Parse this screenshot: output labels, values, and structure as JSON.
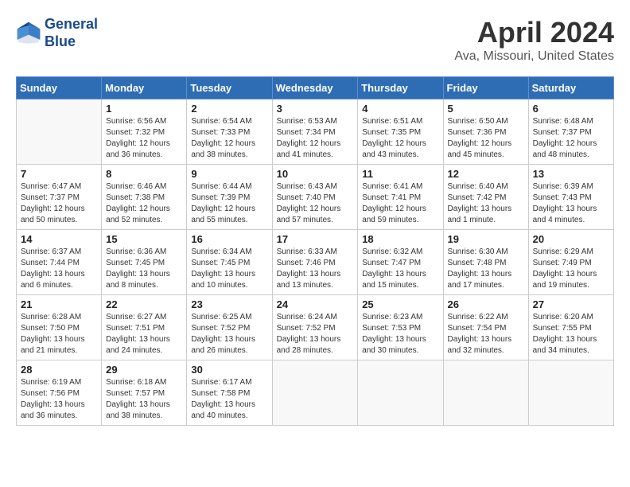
{
  "header": {
    "logo_line1": "General",
    "logo_line2": "Blue",
    "title": "April 2024",
    "subtitle": "Ava, Missouri, United States"
  },
  "days_of_week": [
    "Sunday",
    "Monday",
    "Tuesday",
    "Wednesday",
    "Thursday",
    "Friday",
    "Saturday"
  ],
  "weeks": [
    [
      {
        "day": "",
        "sunrise": "",
        "sunset": "",
        "daylight": "",
        "empty": true
      },
      {
        "day": "1",
        "sunrise": "Sunrise: 6:56 AM",
        "sunset": "Sunset: 7:32 PM",
        "daylight": "Daylight: 12 hours and 36 minutes."
      },
      {
        "day": "2",
        "sunrise": "Sunrise: 6:54 AM",
        "sunset": "Sunset: 7:33 PM",
        "daylight": "Daylight: 12 hours and 38 minutes."
      },
      {
        "day": "3",
        "sunrise": "Sunrise: 6:53 AM",
        "sunset": "Sunset: 7:34 PM",
        "daylight": "Daylight: 12 hours and 41 minutes."
      },
      {
        "day": "4",
        "sunrise": "Sunrise: 6:51 AM",
        "sunset": "Sunset: 7:35 PM",
        "daylight": "Daylight: 12 hours and 43 minutes."
      },
      {
        "day": "5",
        "sunrise": "Sunrise: 6:50 AM",
        "sunset": "Sunset: 7:36 PM",
        "daylight": "Daylight: 12 hours and 45 minutes."
      },
      {
        "day": "6",
        "sunrise": "Sunrise: 6:48 AM",
        "sunset": "Sunset: 7:37 PM",
        "daylight": "Daylight: 12 hours and 48 minutes."
      }
    ],
    [
      {
        "day": "7",
        "sunrise": "Sunrise: 6:47 AM",
        "sunset": "Sunset: 7:37 PM",
        "daylight": "Daylight: 12 hours and 50 minutes."
      },
      {
        "day": "8",
        "sunrise": "Sunrise: 6:46 AM",
        "sunset": "Sunset: 7:38 PM",
        "daylight": "Daylight: 12 hours and 52 minutes."
      },
      {
        "day": "9",
        "sunrise": "Sunrise: 6:44 AM",
        "sunset": "Sunset: 7:39 PM",
        "daylight": "Daylight: 12 hours and 55 minutes."
      },
      {
        "day": "10",
        "sunrise": "Sunrise: 6:43 AM",
        "sunset": "Sunset: 7:40 PM",
        "daylight": "Daylight: 12 hours and 57 minutes."
      },
      {
        "day": "11",
        "sunrise": "Sunrise: 6:41 AM",
        "sunset": "Sunset: 7:41 PM",
        "daylight": "Daylight: 12 hours and 59 minutes."
      },
      {
        "day": "12",
        "sunrise": "Sunrise: 6:40 AM",
        "sunset": "Sunset: 7:42 PM",
        "daylight": "Daylight: 13 hours and 1 minute."
      },
      {
        "day": "13",
        "sunrise": "Sunrise: 6:39 AM",
        "sunset": "Sunset: 7:43 PM",
        "daylight": "Daylight: 13 hours and 4 minutes."
      }
    ],
    [
      {
        "day": "14",
        "sunrise": "Sunrise: 6:37 AM",
        "sunset": "Sunset: 7:44 PM",
        "daylight": "Daylight: 13 hours and 6 minutes."
      },
      {
        "day": "15",
        "sunrise": "Sunrise: 6:36 AM",
        "sunset": "Sunset: 7:45 PM",
        "daylight": "Daylight: 13 hours and 8 minutes."
      },
      {
        "day": "16",
        "sunrise": "Sunrise: 6:34 AM",
        "sunset": "Sunset: 7:45 PM",
        "daylight": "Daylight: 13 hours and 10 minutes."
      },
      {
        "day": "17",
        "sunrise": "Sunrise: 6:33 AM",
        "sunset": "Sunset: 7:46 PM",
        "daylight": "Daylight: 13 hours and 13 minutes."
      },
      {
        "day": "18",
        "sunrise": "Sunrise: 6:32 AM",
        "sunset": "Sunset: 7:47 PM",
        "daylight": "Daylight: 13 hours and 15 minutes."
      },
      {
        "day": "19",
        "sunrise": "Sunrise: 6:30 AM",
        "sunset": "Sunset: 7:48 PM",
        "daylight": "Daylight: 13 hours and 17 minutes."
      },
      {
        "day": "20",
        "sunrise": "Sunrise: 6:29 AM",
        "sunset": "Sunset: 7:49 PM",
        "daylight": "Daylight: 13 hours and 19 minutes."
      }
    ],
    [
      {
        "day": "21",
        "sunrise": "Sunrise: 6:28 AM",
        "sunset": "Sunset: 7:50 PM",
        "daylight": "Daylight: 13 hours and 21 minutes."
      },
      {
        "day": "22",
        "sunrise": "Sunrise: 6:27 AM",
        "sunset": "Sunset: 7:51 PM",
        "daylight": "Daylight: 13 hours and 24 minutes."
      },
      {
        "day": "23",
        "sunrise": "Sunrise: 6:25 AM",
        "sunset": "Sunset: 7:52 PM",
        "daylight": "Daylight: 13 hours and 26 minutes."
      },
      {
        "day": "24",
        "sunrise": "Sunrise: 6:24 AM",
        "sunset": "Sunset: 7:52 PM",
        "daylight": "Daylight: 13 hours and 28 minutes."
      },
      {
        "day": "25",
        "sunrise": "Sunrise: 6:23 AM",
        "sunset": "Sunset: 7:53 PM",
        "daylight": "Daylight: 13 hours and 30 minutes."
      },
      {
        "day": "26",
        "sunrise": "Sunrise: 6:22 AM",
        "sunset": "Sunset: 7:54 PM",
        "daylight": "Daylight: 13 hours and 32 minutes."
      },
      {
        "day": "27",
        "sunrise": "Sunrise: 6:20 AM",
        "sunset": "Sunset: 7:55 PM",
        "daylight": "Daylight: 13 hours and 34 minutes."
      }
    ],
    [
      {
        "day": "28",
        "sunrise": "Sunrise: 6:19 AM",
        "sunset": "Sunset: 7:56 PM",
        "daylight": "Daylight: 13 hours and 36 minutes."
      },
      {
        "day": "29",
        "sunrise": "Sunrise: 6:18 AM",
        "sunset": "Sunset: 7:57 PM",
        "daylight": "Daylight: 13 hours and 38 minutes."
      },
      {
        "day": "30",
        "sunrise": "Sunrise: 6:17 AM",
        "sunset": "Sunset: 7:58 PM",
        "daylight": "Daylight: 13 hours and 40 minutes."
      },
      {
        "day": "",
        "sunrise": "",
        "sunset": "",
        "daylight": "",
        "empty": true
      },
      {
        "day": "",
        "sunrise": "",
        "sunset": "",
        "daylight": "",
        "empty": true
      },
      {
        "day": "",
        "sunrise": "",
        "sunset": "",
        "daylight": "",
        "empty": true
      },
      {
        "day": "",
        "sunrise": "",
        "sunset": "",
        "daylight": "",
        "empty": true
      }
    ]
  ]
}
